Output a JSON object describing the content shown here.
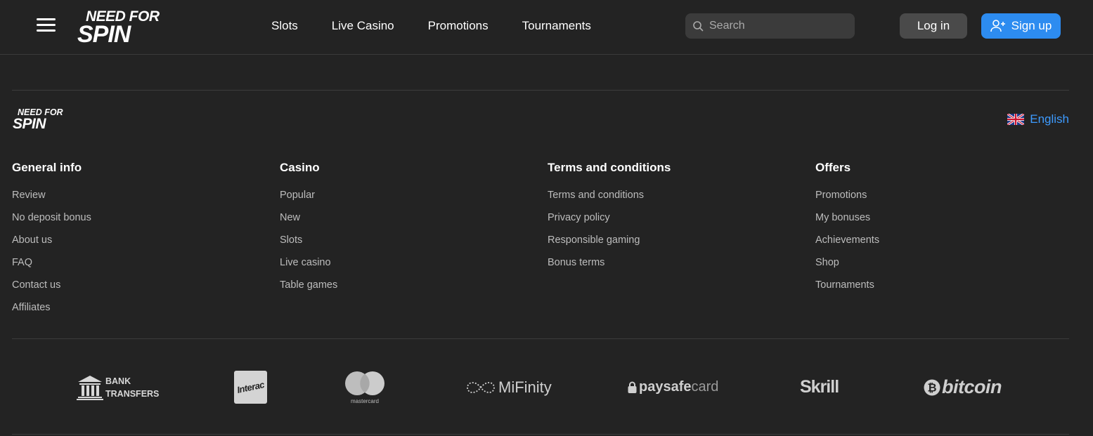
{
  "header": {
    "logo_line1": "NEED FOR",
    "logo_line2": "SPIN",
    "nav": [
      "Slots",
      "Live Casino",
      "Promotions",
      "Tournaments"
    ],
    "search_placeholder": "Search",
    "login_label": "Log in",
    "signup_label": "Sign up"
  },
  "footer": {
    "logo_line1": "NEED FOR",
    "logo_line2": "SPIN",
    "language": "English",
    "columns": [
      {
        "title": "General info",
        "links": [
          "Review",
          "No deposit bonus",
          "About us",
          "FAQ",
          "Contact us",
          "Affiliates"
        ]
      },
      {
        "title": "Casino",
        "links": [
          "Popular",
          "New",
          "Slots",
          "Live casino",
          "Table games"
        ]
      },
      {
        "title": "Terms and conditions",
        "links": [
          "Terms and conditions",
          "Privacy policy",
          "Responsible gaming",
          "Bonus terms"
        ]
      },
      {
        "title": "Offers",
        "links": [
          "Promotions",
          "My bonuses",
          "Achievements",
          "Shop",
          "Tournaments"
        ]
      }
    ],
    "payments": {
      "bank_line1": "BANK",
      "bank_line2": "TRANSFERS",
      "interac": "Interac",
      "mastercard": "mastercard",
      "mifinity": "MiFinity",
      "paysafe_bold": "paysafe",
      "paysafe_light": "card",
      "skrill": "Skrill",
      "bitcoin": "bitcoin"
    }
  },
  "colors": {
    "background": "#232323",
    "accent": "#2d8cf0",
    "link": "#3d9bff"
  }
}
